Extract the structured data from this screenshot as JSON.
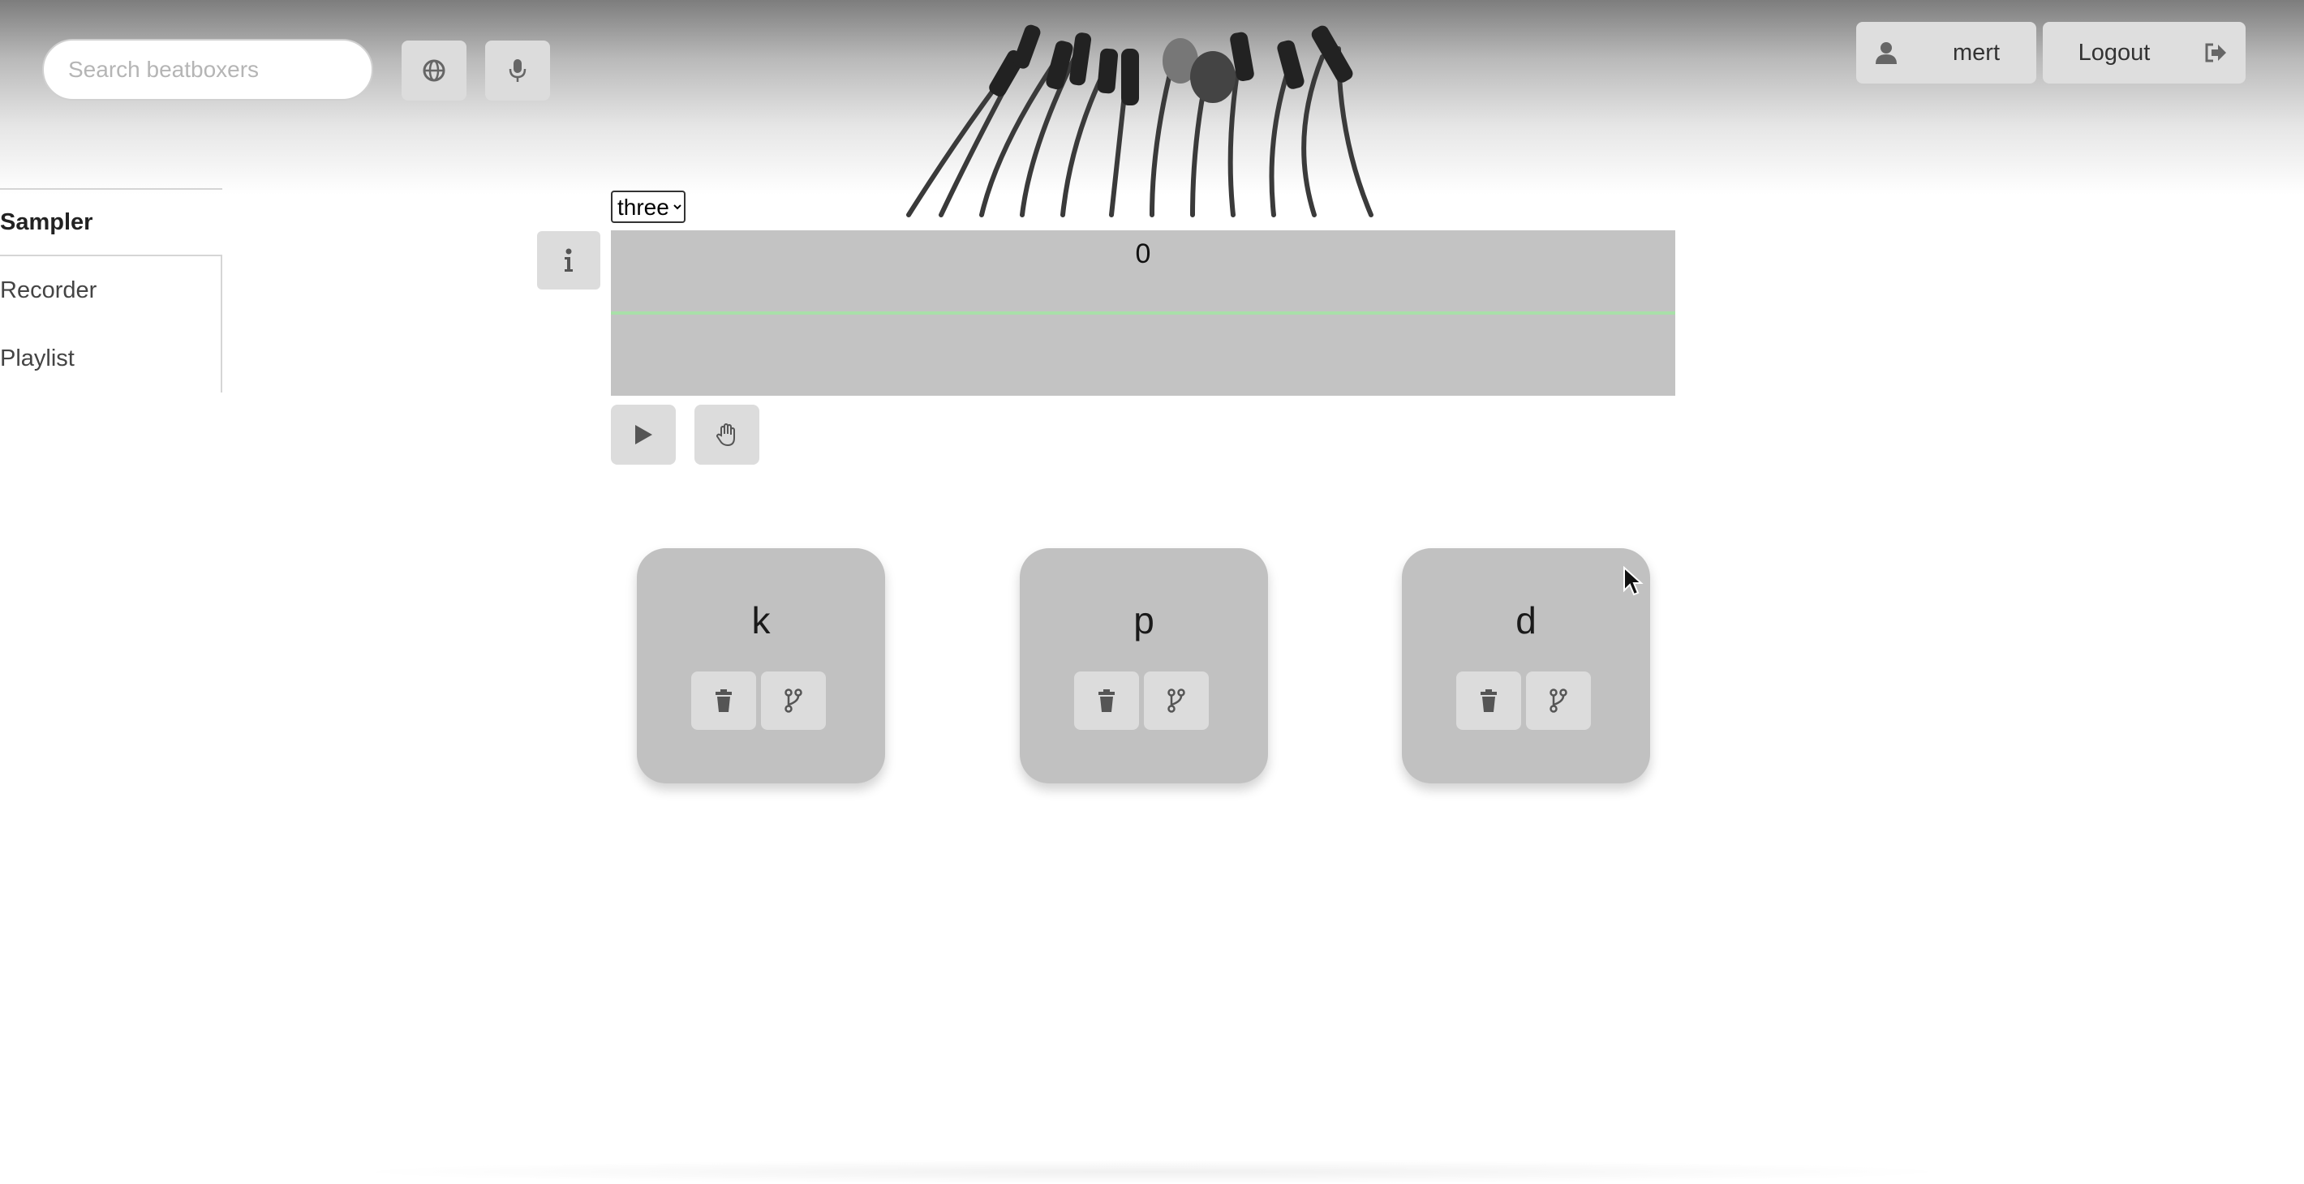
{
  "search": {
    "placeholder": "Search beatboxers",
    "icon": "search-icon"
  },
  "header": {
    "language_icon": "globe-icon",
    "record_icon": "microphone-icon",
    "username": "mert",
    "logout_label": "Logout"
  },
  "sidebar": {
    "items": [
      {
        "label": "Sampler",
        "active": true
      },
      {
        "label": "Recorder",
        "active": false
      },
      {
        "label": "Playlist",
        "active": false
      }
    ]
  },
  "sampler": {
    "selected_option": "three",
    "counter": "0",
    "waveform_line_color": "#a8e0a8"
  },
  "samples": [
    {
      "letter": "k"
    },
    {
      "letter": "p"
    },
    {
      "letter": "d"
    }
  ],
  "colors": {
    "panel_gray": "#c1c1c1",
    "button_gray": "#dcdcdc"
  }
}
